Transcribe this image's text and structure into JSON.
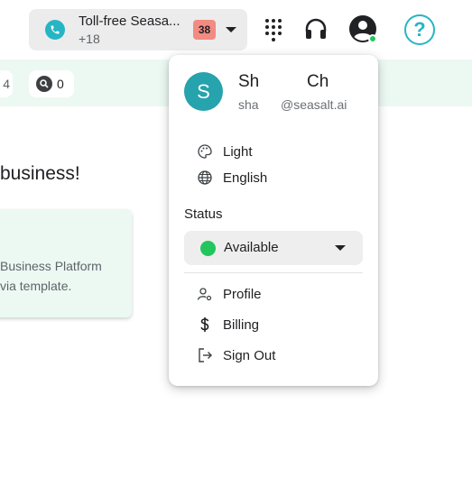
{
  "topbar": {
    "phone": {
      "title": "Toll-free Seasa...",
      "number_prefix": "+18",
      "count_badge": "38",
      "icon": "phone-icon",
      "accent_color": "#26b5c4",
      "badge_color": "#f28b82"
    },
    "icons": [
      "dialpad-icon",
      "headset-icon",
      "account-circle-icon",
      "help-icon"
    ],
    "help_label": "?",
    "presence_color": "#22c55e"
  },
  "background": {
    "chip_a_value": "4",
    "chip_b_value": "0",
    "heading_partial": "business!",
    "card_line1": "Business Platform",
    "card_line2": "via template."
  },
  "menu": {
    "avatar_initial": "S",
    "avatar_color": "#26a3ad",
    "user_first": "Sh",
    "user_last": "Ch",
    "email_prefix": "sha",
    "email_domain": "@seasalt.ai",
    "items_top": [
      {
        "label": "Light",
        "icon": "palette-icon"
      },
      {
        "label": "English",
        "icon": "globe-icon"
      }
    ],
    "status_heading": "Status",
    "status_value": "Available",
    "status_color": "#22c55e",
    "items_bottom": [
      {
        "label": "Profile",
        "icon": "manage-account-icon"
      },
      {
        "label": "Billing",
        "icon": "dollar-icon"
      },
      {
        "label": "Sign Out",
        "icon": "logout-icon"
      }
    ]
  }
}
